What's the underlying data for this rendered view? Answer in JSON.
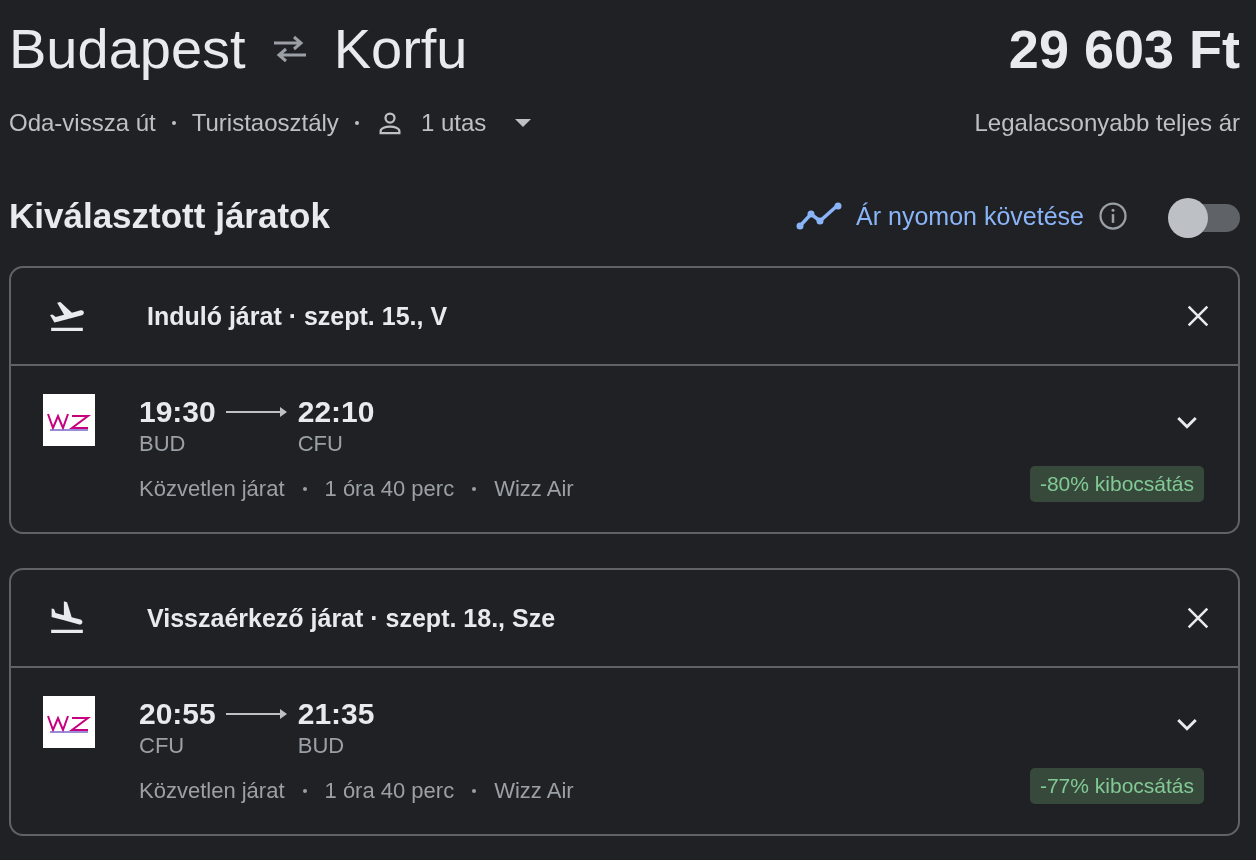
{
  "route": {
    "origin": "Budapest",
    "destination": "Korfu",
    "price": "29 603 Ft",
    "price_caption": "Legalacsonyabb teljes ár"
  },
  "trip_options": {
    "trip_type": "Oda-vissza út",
    "cabin_class": "Turistaosztály",
    "passengers": "1 utas"
  },
  "section_title": "Kiválasztott járatok",
  "price_tracking": {
    "label": "Ár nyomon követése",
    "on": false
  },
  "flights": [
    {
      "kind": "departure",
      "title": "Induló járat · szept. 15., V",
      "depart_time": "19:30",
      "arrive_time": "22:10",
      "depart_code": "BUD",
      "arrive_code": "CFU",
      "details": [
        "Közvetlen járat",
        "1 óra 40 perc",
        "Wizz Air"
      ],
      "emissions": "-80% kibocsátás",
      "expanded": false
    },
    {
      "kind": "return",
      "title": "Visszaérkező járat · szept. 18., Sze",
      "depart_time": "20:55",
      "arrive_time": "21:35",
      "depart_code": "CFU",
      "arrive_code": "BUD",
      "details": [
        "Közvetlen járat",
        "1 óra 40 perc",
        "Wizz Air"
      ],
      "emissions": "-77% kibocsátás",
      "expanded": false
    }
  ]
}
